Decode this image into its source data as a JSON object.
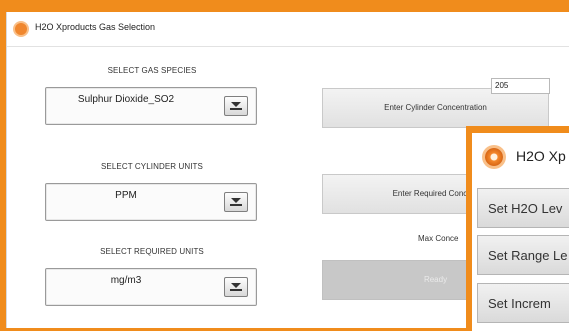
{
  "window": {
    "title": "H2O Xproducts Gas Selection"
  },
  "gas_species": {
    "label": "SELECT GAS SPECIES",
    "value": "Sulphur Dioxide_SO2"
  },
  "cylinder_units": {
    "label": "SELECT CYLINDER UNITS",
    "value": "PPM"
  },
  "required_units": {
    "label": "SELECT REQUIRED UNITS",
    "value": "mg/m3"
  },
  "buttons": {
    "cylinder_concentration": "Enter Cylinder Concentration",
    "required_concentration": "Enter Required Concent",
    "ready": "Ready"
  },
  "cylinder_concentration_value": "205",
  "max_label": "Max Conce",
  "overlay": {
    "title": "H2O Xp",
    "buttons": [
      "Set H2O Lev",
      "Set Range Le",
      "Set Increm"
    ]
  },
  "colors": {
    "accent": "#f08c1c",
    "icon": "#f0872e"
  }
}
